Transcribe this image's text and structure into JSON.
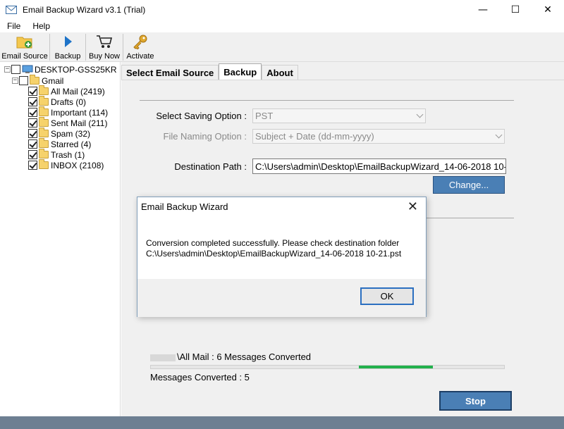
{
  "window": {
    "title": "Email Backup Wizard v3.1 (Trial)",
    "minimize": "—",
    "maximize": "☐",
    "close": "✕"
  },
  "menu": [
    "File",
    "Help"
  ],
  "toolbar": {
    "email_source": "Email Source",
    "backup": "Backup",
    "buy_now": "Buy Now",
    "activate": "Activate"
  },
  "tree": {
    "root": "DESKTOP-GSS25KR",
    "account": "Gmail",
    "folders": [
      {
        "label": "All Mail (2419)",
        "checked": true
      },
      {
        "label": "Drafts (0)",
        "checked": true
      },
      {
        "label": "Important (114)",
        "checked": true
      },
      {
        "label": "Sent Mail (211)",
        "checked": true
      },
      {
        "label": "Spam (32)",
        "checked": true
      },
      {
        "label": "Starred (4)",
        "checked": true
      },
      {
        "label": "Trash (1)",
        "checked": true
      },
      {
        "label": "INBOX (2108)",
        "checked": true
      }
    ]
  },
  "tabs": [
    "Select Email Source",
    "Backup",
    "About"
  ],
  "form": {
    "saving_option_label": "Select Saving Option :",
    "saving_option_value": "PST",
    "naming_option_label": "File Naming Option :",
    "naming_option_value": "Subject + Date (dd-mm-yyyy)",
    "destination_label": "Destination Path :",
    "destination_value": "C:\\Users\\admin\\Desktop\\EmailBackupWizard_14-06-2018 10-21.pst",
    "change_button": "Change..."
  },
  "progress": {
    "status": "\\All Mail : 6 Messages Converted",
    "converted": "Messages Converted : 5",
    "stop_button": "Stop"
  },
  "dialog": {
    "title": "Email Backup Wizard",
    "close": "✕",
    "message_line1": "Conversion completed successfully. Please check destination folder",
    "message_line2": "C:\\Users\\admin\\Desktop\\EmailBackupWizard_14-06-2018 10-21.pst",
    "ok": "OK"
  }
}
